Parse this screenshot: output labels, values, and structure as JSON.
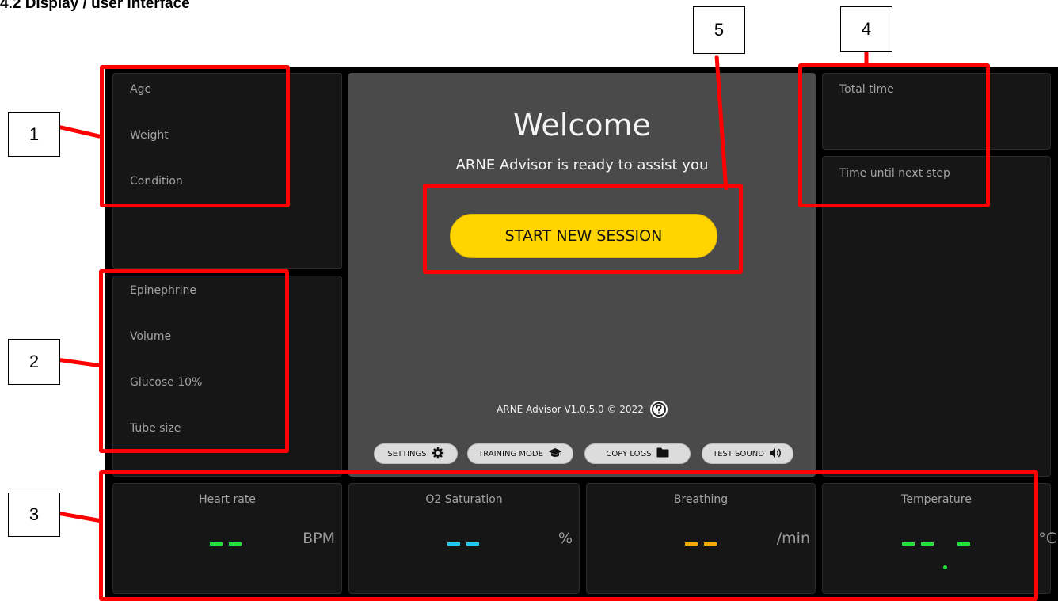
{
  "document": {
    "heading": "4.2 Display / user interface"
  },
  "patient": {
    "age_label": "Age",
    "weight_label": "Weight",
    "condition_label": "Condition"
  },
  "medication": {
    "epinephrine_label": "Epinephrine",
    "volume_label": "Volume",
    "glucose_label": "Glucose 10%",
    "tube_label": "Tube size"
  },
  "timers": {
    "total_label": "Total time",
    "next_step_label": "Time until next step"
  },
  "welcome": {
    "title": "Welcome",
    "subtitle": "ARNE Advisor is ready to assist you",
    "start_button": "START NEW SESSION",
    "version": "ARNE Advisor V1.0.5.0 © 2022"
  },
  "actions": {
    "settings": "SETTINGS",
    "training_mode": "TRAINING MODE",
    "copy_logs": "COPY LOGS",
    "test_sound": "TEST SOUND"
  },
  "vitals": {
    "heart_rate": {
      "label": "Heart rate",
      "unit": "BPM",
      "color": "#22e03a"
    },
    "o2": {
      "label": "O2 Saturation",
      "unit": "%",
      "color": "#1ec8f0"
    },
    "breathing": {
      "label": "Breathing",
      "unit": "/min",
      "color": "#f5a800"
    },
    "temperature": {
      "label": "Temperature",
      "unit": "°C",
      "color": "#22e03a"
    }
  },
  "callouts": {
    "c1": "1",
    "c2": "2",
    "c3": "3",
    "c4": "4",
    "c5": "5"
  },
  "icons": {
    "settings": "gear-icon",
    "training": "graduation-cap-icon",
    "copy_logs": "folder-icon",
    "test_sound": "speaker-icon",
    "help": "question-circle-icon"
  },
  "colors": {
    "accent": "#ffd400",
    "highlight": "#ff0000"
  }
}
